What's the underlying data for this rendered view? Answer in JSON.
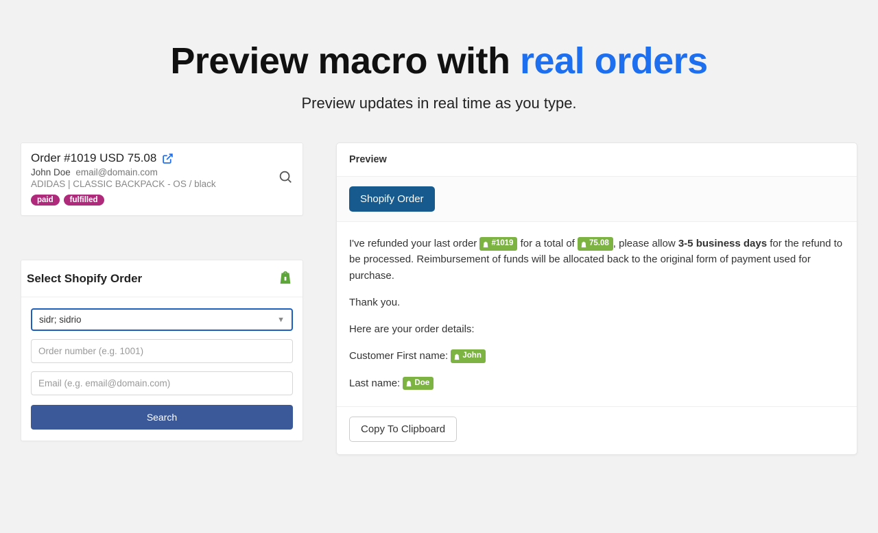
{
  "hero": {
    "title_plain": "Preview macro with ",
    "title_accent": "real orders",
    "subtitle": "Preview updates in real time as you type."
  },
  "order_card": {
    "title": "Order #1019 USD 75.08",
    "customer_name": "John Doe",
    "customer_email": "email@domain.com",
    "product_line": "ADIDAS | CLASSIC BACKPACK - OS / black",
    "tag_paid": "paid",
    "tag_fulfilled": "fulfilled"
  },
  "select_panel": {
    "heading": "Select Shopify Order",
    "store_value": "sidr; sidrio",
    "order_placeholder": "Order number (e.g. 1001)",
    "email_placeholder": "Email (e.g. email@domain.com)",
    "search_label": "Search"
  },
  "preview": {
    "header": "Preview",
    "button_label": "Shopify Order",
    "body": {
      "line1_a": "I've refunded your last order ",
      "token_order": "#1019",
      "line1_b": " for a total of ",
      "token_total": "75.08",
      "line1_c": ", please allow ",
      "bold_days": "3-5 business days",
      "line1_d": " for the refund to be processed. Reimbursement of funds will be allocated back to the original form of payment used for purchase.",
      "line2": "Thank you.",
      "line3": "Here are your order details:",
      "line4_label": "Customer First name: ",
      "token_first": "John",
      "line5_label": "Last name: ",
      "token_last": "Doe"
    },
    "copy_label": "Copy To Clipboard"
  }
}
